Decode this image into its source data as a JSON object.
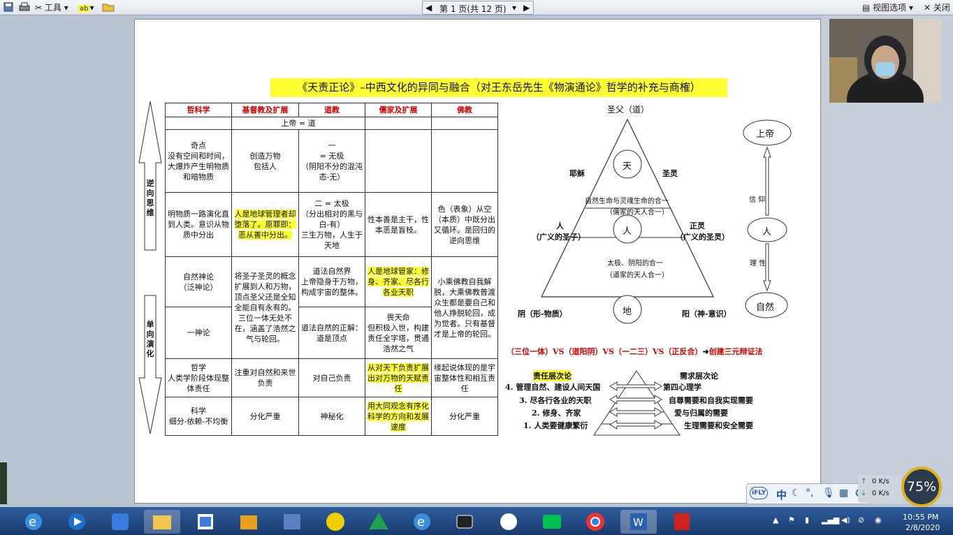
{
  "toolbar": {
    "tools_label": "工具",
    "page_indicator": "第 1 页(共 12 页)",
    "view_options": "视图选项",
    "close_label": "关闭"
  },
  "doc": {
    "title": "《天责正论》–中西文化的异同与融合（对王东岳先生《物演通论》哲学的补充与商榷）",
    "left_labels": {
      "up": "逆向思维",
      "down": "单向演化"
    },
    "table": {
      "headers": [
        "哲科学",
        "基督教及扩展",
        "道教",
        "儒家及扩展",
        "佛教"
      ],
      "god_row": "上帝 = 道",
      "rows": [
        [
          "奇点\n没有空间和时间，大爆炸产生明物质和暗物质",
          "创造万物\n包括人",
          "一\n= 无极\n（阴阳不分的混沌态-无）",
          "",
          ""
        ],
        [
          "明物质一路演化直到人类。意识从物质中分出",
          "人是地球管理者却堕落了。原罪即：恶从善中分出。",
          "二 = 太极\n（分出相对的黑与白-有）\n三生万物，人生于天地",
          "性本善是主干，性本恶是盲枝。",
          "色（表象）从空（本质）中既分出又循环。是回归的逆向思维"
        ],
        [
          "自然神论\n（泛神论）",
          "将圣子圣灵的概念扩展到人和万物，顶点圣父还是全知全能自有永有的。三位一体无处不在，涵盖了浩然之气与轮回。",
          "道法自然界\n上帝隐身于万物，构成宇宙的整体。",
          "人是地球管家：修身、齐家、尽各行各业天职",
          "小乘佛教自我解脱，大乘佛教普渡众生都是要自己和他人挣脱轮回，成为觉者。只有基督才是上帝的轮回。"
        ],
        [
          "一神论",
          "",
          "道法自然的正解：道是顶点",
          "畏天命\n但积极入世，构建责任全字塔，贯通浩然之气",
          ""
        ],
        [
          "哲学\n人类学阶段体现整体责任",
          "注重对自然和来世负责",
          "对自己负责",
          "从对天下负责扩展出对万物的天赋责任",
          "缘起说体现的是宇宙整体性和相互责任"
        ],
        [
          "科学\n细分-依赖-不均衡",
          "分化严重",
          "神秘化",
          "用大同观念有序化科学的方向和发展速度",
          "分化严重"
        ]
      ]
    },
    "diagram": {
      "top": "圣父（道）",
      "tian": "天",
      "ren": "人",
      "di": "地",
      "jesus": "耶稣",
      "holy_spirit": "圣灵",
      "mid_text1": "自然生命与灵魂生命的合一",
      "mid_text2": "（儒家的天人合一）",
      "person_left": "人",
      "person_left_sub": "（广义的圣子）",
      "right_spirit": "正灵",
      "right_spirit_sub": "（广义的圣灵）",
      "low_text1": "太极、阴阳的合一",
      "low_text2": "（道家的天人合一）",
      "yin": "阴（形-物质）",
      "yang": "阳（神-意识）",
      "god": "上帝",
      "human": "人",
      "nature": "自然",
      "faith": "信 仰",
      "reason": "理 性",
      "red_line": "（三位一体）VS（道阳阴）VS（一二三）VS（正反合）",
      "red_arrow_text": "创建三元辩证法",
      "resp_title": "责任层次论",
      "need_title": "需求层次论",
      "resp": [
        "4. 管理自然、建设人间天国",
        "3. 尽各行各业的天职",
        "2. 修身、齐家",
        "1. 人类要健康繁衍"
      ],
      "needs": [
        "第四心理学",
        "自尊需要和自我实现需要",
        "爱与归属的需要",
        "生理需要和安全需要"
      ]
    }
  },
  "ime": {
    "mode": "中",
    "brand": "iFLY"
  },
  "net": {
    "up": "0 K/s",
    "down": "0 K/s",
    "percent": "75%"
  },
  "clock": {
    "time": "10:55 PM",
    "date": "2/8/2020"
  }
}
